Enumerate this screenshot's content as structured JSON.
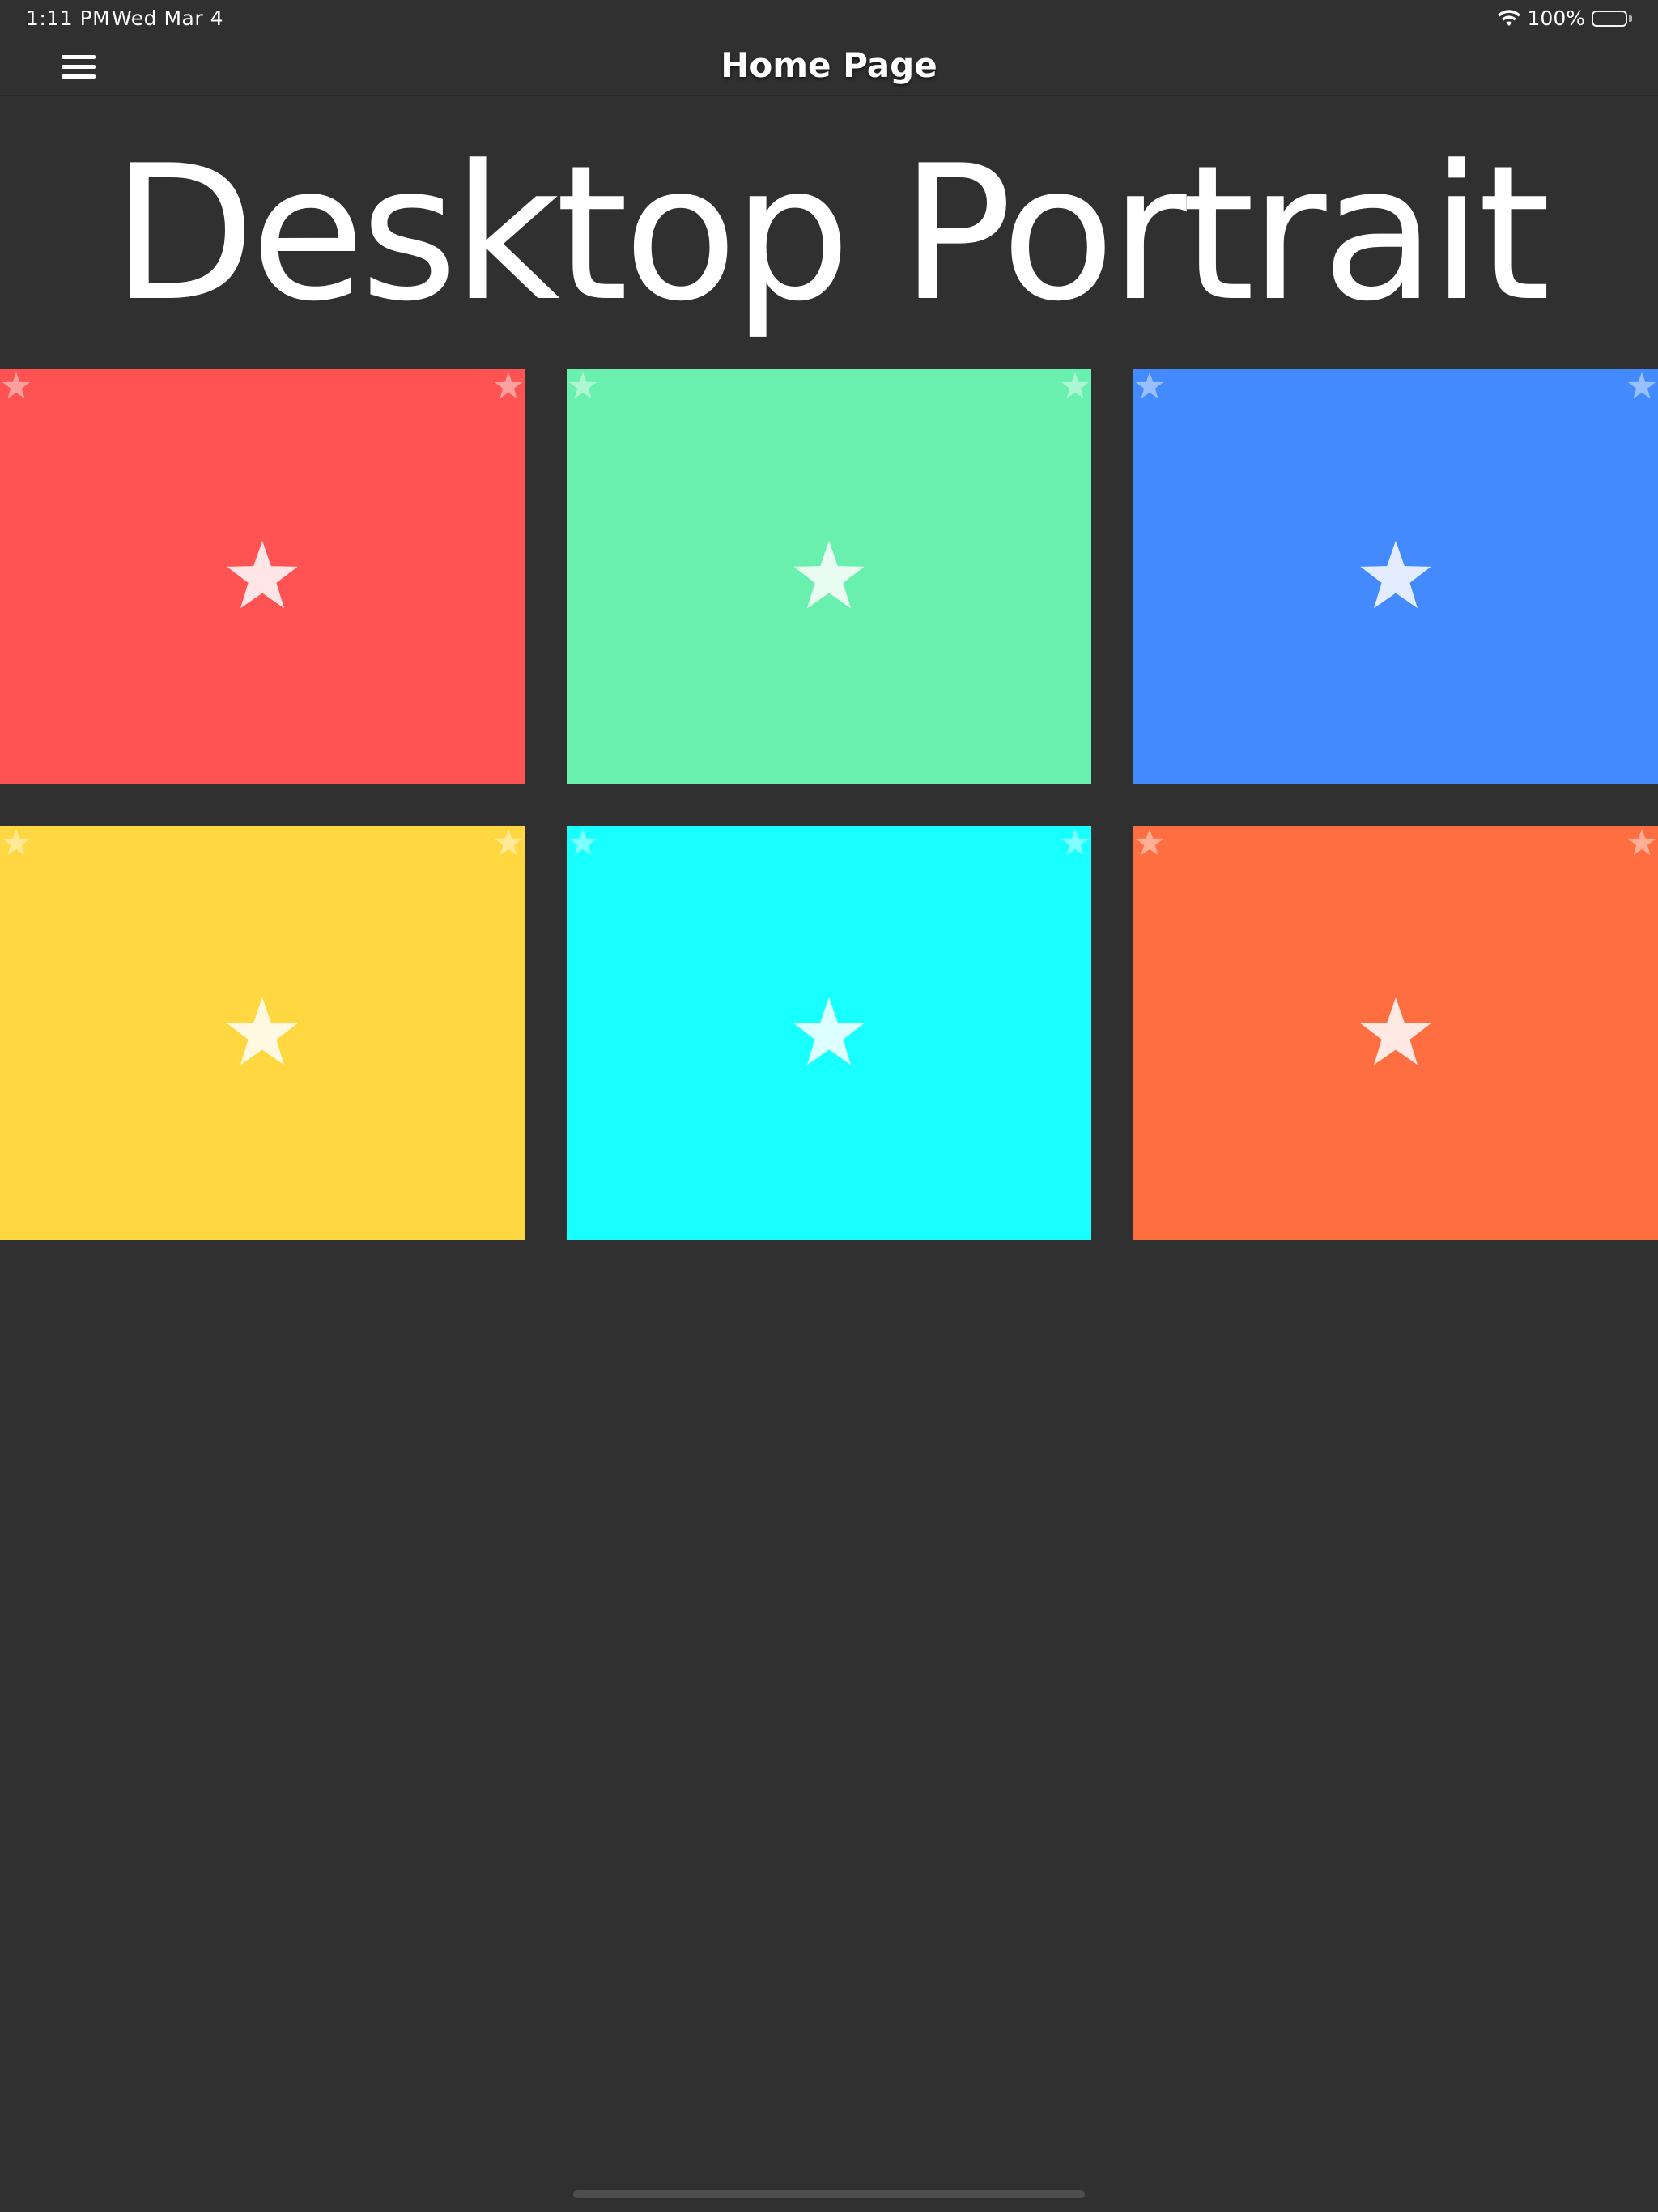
{
  "status_bar": {
    "time": "1:11 PM",
    "date": "Wed Mar 4",
    "battery": "100%",
    "icons": [
      "wifi-icon",
      "battery-icon"
    ]
  },
  "nav": {
    "title": "Home Page",
    "menu_icon": "hamburger-menu-icon"
  },
  "heading": "Desktop Portrait",
  "tiles": [
    {
      "color": "#ff5252",
      "icon": "star-icon"
    },
    {
      "color": "#69f0ae",
      "icon": "star-icon"
    },
    {
      "color": "#448aff",
      "icon": "star-icon"
    },
    {
      "color": "#ffd740",
      "icon": "star-icon"
    },
    {
      "color": "#18ffff",
      "icon": "star-icon"
    },
    {
      "color": "#ff6e40",
      "icon": "star-icon"
    }
  ],
  "colors": {
    "background": "#303030",
    "text": "#ffffff"
  }
}
